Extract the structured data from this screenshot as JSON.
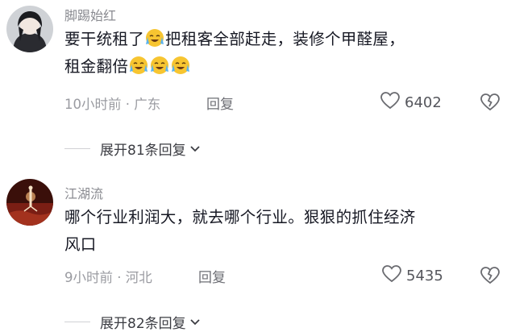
{
  "comments": [
    {
      "username": "脚踢始红",
      "text_parts": [
        "要干统租了",
        "把租客全部赶走，装修个甲醛屋，",
        "租金翻倍"
      ],
      "emoji_name": "cry-laugh-emoji",
      "meta": "10小时前 · 广东",
      "reply_label": "回复",
      "likes": "6402",
      "expand_label": "展开81条回复"
    },
    {
      "username": "江湖流",
      "text_line1": "哪个行业利润大，就去哪个行业。狠狠的抓住经济",
      "text_line2": "风口",
      "meta": "9小时前 · 河北",
      "reply_label": "回复",
      "likes": "5435",
      "expand_label": "展开82条回复"
    }
  ],
  "colors": {
    "text": "#161823",
    "meta": "#9a9ba1",
    "emoji_face": "#f7c531"
  }
}
